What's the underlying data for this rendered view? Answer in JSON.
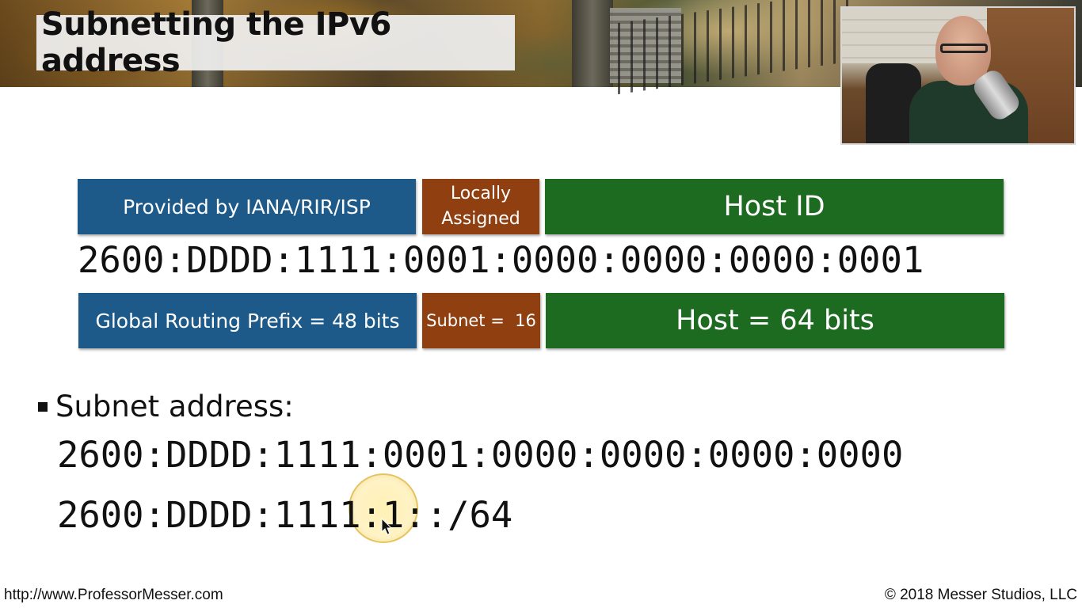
{
  "slide": {
    "title": "Subnetting the IPv6 address",
    "top_labels": {
      "provider": "Provided by IANA/RIR/ISP",
      "locally_line1": "Locally",
      "locally_line2": "Assigned",
      "host_id": "Host ID"
    },
    "full_address": "2600:DDDD:1111:0001:0000:0000:0000:0001",
    "bottom_labels": {
      "global_prefix": "Global Routing Prefix = 48 bits",
      "subnet": "Subnet =  16",
      "host": "Host = 64 bits"
    },
    "bullet": "Subnet address:",
    "subnet_full": "2600:DDDD:1111:0001:0000:0000:0000:0000",
    "subnet_short": "2600:DDDD:1111:1::/64",
    "footer_left": "http://www.ProfessorMesser.com",
    "footer_right": "© 2018 Messer Studios, LLC"
  },
  "colors": {
    "provider_blue": "#1d5a89",
    "local_brown": "#8f3f10",
    "host_green": "#1d6a21"
  },
  "icons": [
    "cursor-arrow-icon"
  ]
}
